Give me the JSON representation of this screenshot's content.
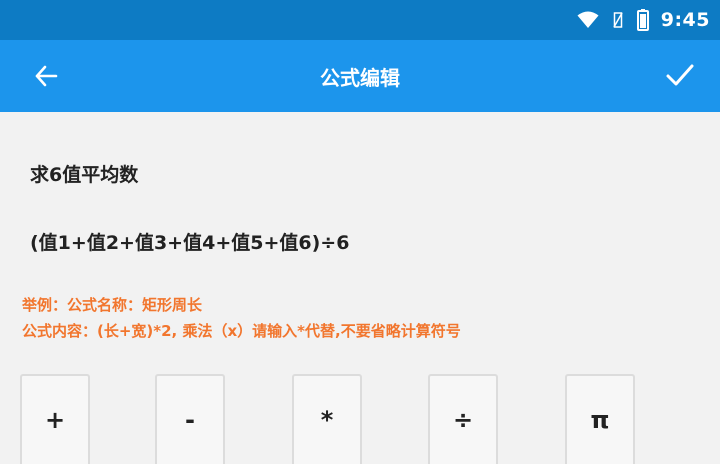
{
  "status_bar": {
    "time": "9:45",
    "icons": [
      "wifi-icon",
      "signal-off-icon",
      "battery-icon"
    ]
  },
  "app_bar": {
    "title": "公式编辑",
    "back_icon": "arrow-left-icon",
    "confirm_icon": "checkmark-icon"
  },
  "form": {
    "name_value": "求6值平均数",
    "content_value": "(值1+值2+值3+值4+值5+值6)÷6"
  },
  "hint": {
    "line1": "举例：公式名称：矩形周长",
    "line2": "公式内容：(长+宽)*2, 乘法（x）请输入*代替,不要省略计算符号"
  },
  "keypad": {
    "keys": [
      "+",
      "-",
      "*",
      "÷",
      "π"
    ]
  },
  "colors": {
    "status_bar": "#0d7bc4",
    "app_bar": "#1c95ec",
    "hint_text": "#f2762e",
    "background": "#f2f2f2"
  }
}
